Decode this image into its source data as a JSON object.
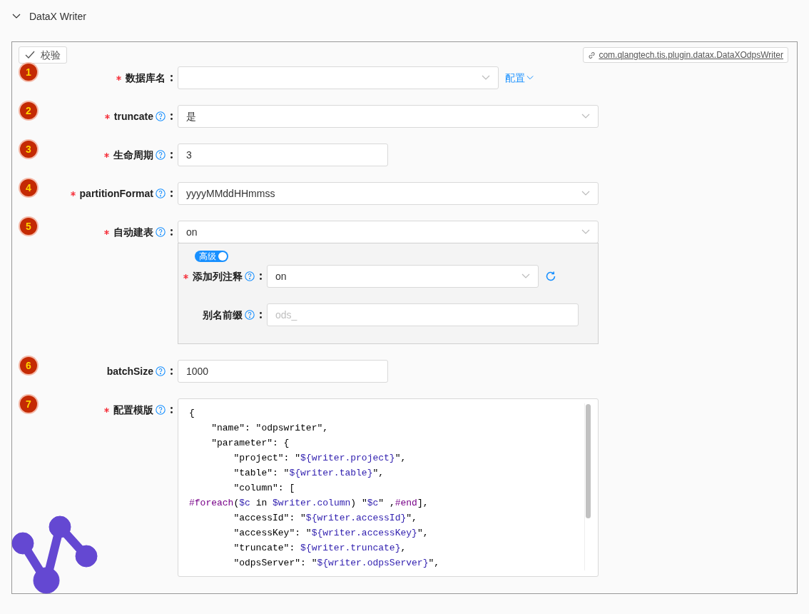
{
  "section": {
    "title": "DataX Writer",
    "expanded": true
  },
  "validate_button": "校验",
  "plugin_link": "com.qlangtech.tis.plugin.datax.DataXOdpsWriter",
  "fields": [
    {
      "badge": "1",
      "label": "数据库名",
      "required": true,
      "help": false,
      "kind": "select",
      "link": "配置"
    },
    {
      "badge": "2",
      "label": "truncate",
      "required": true,
      "help": true,
      "kind": "select",
      "value": "是"
    },
    {
      "badge": "3",
      "label": "生命周期",
      "required": true,
      "help": true,
      "kind": "input",
      "value": "3"
    },
    {
      "badge": "4",
      "label": "partitionFormat",
      "required": true,
      "help": true,
      "kind": "select",
      "value": "yyyyMMddHHmmss"
    },
    {
      "badge": "5",
      "label": "自动建表",
      "required": true,
      "help": true,
      "kind": "select",
      "value": "on",
      "advanced": {
        "toggle": {
          "label": "高级",
          "on": true
        },
        "fields": [
          {
            "label": "添加列注释",
            "required": true,
            "help": true,
            "kind": "select",
            "value": "on",
            "refresh": true
          },
          {
            "label": "别名前缀",
            "required": false,
            "help": true,
            "kind": "input",
            "placeholder": "ods_"
          }
        ]
      }
    },
    {
      "badge": "6",
      "label": "batchSize",
      "required": false,
      "help": true,
      "kind": "input",
      "value": "1000"
    },
    {
      "badge": "7",
      "label": "配置模版",
      "required": true,
      "help": true,
      "kind": "code",
      "lines": [
        [
          {
            "kind": "plain",
            "text": "{"
          }
        ],
        [
          {
            "kind": "plain",
            "text": "    \"name\": \"odpswriter\","
          }
        ],
        [
          {
            "kind": "plain",
            "text": "    \"parameter\": {"
          }
        ],
        [
          {
            "kind": "plain",
            "text": "        \"project\": \""
          },
          {
            "kind": "var",
            "text": "${writer.project}"
          },
          {
            "kind": "plain",
            "text": "\","
          }
        ],
        [
          {
            "kind": "plain",
            "text": "        \"table\": \""
          },
          {
            "kind": "var",
            "text": "${writer.table}"
          },
          {
            "kind": "plain",
            "text": "\","
          }
        ],
        [
          {
            "kind": "plain",
            "text": "        \"column\": ["
          }
        ],
        [
          {
            "kind": "directive",
            "text": "#foreach"
          },
          {
            "kind": "plain",
            "text": "("
          },
          {
            "kind": "var",
            "text": "$c"
          },
          {
            "kind": "plain",
            "text": " in "
          },
          {
            "kind": "var",
            "text": "$writer.column"
          },
          {
            "kind": "plain",
            "text": ") \""
          },
          {
            "kind": "var",
            "text": "$c"
          },
          {
            "kind": "plain",
            "text": "\" ,"
          },
          {
            "kind": "directive",
            "text": "#end"
          },
          {
            "kind": "plain",
            "text": "],"
          }
        ],
        [
          {
            "kind": "plain",
            "text": "        \"accessId\": \""
          },
          {
            "kind": "var",
            "text": "${writer.accessId}"
          },
          {
            "kind": "plain",
            "text": "\","
          }
        ],
        [
          {
            "kind": "plain",
            "text": "        \"accessKey\": \""
          },
          {
            "kind": "var",
            "text": "${writer.accessKey}"
          },
          {
            "kind": "plain",
            "text": "\","
          }
        ],
        [
          {
            "kind": "plain",
            "text": "        \"truncate\": "
          },
          {
            "kind": "var",
            "text": "${writer.truncate}"
          },
          {
            "kind": "plain",
            "text": ","
          }
        ],
        [
          {
            "kind": "plain",
            "text": "        \"odpsServer\": \""
          },
          {
            "kind": "var",
            "text": "${writer.odpsServer}"
          },
          {
            "kind": "plain",
            "text": "\","
          }
        ]
      ]
    }
  ]
}
